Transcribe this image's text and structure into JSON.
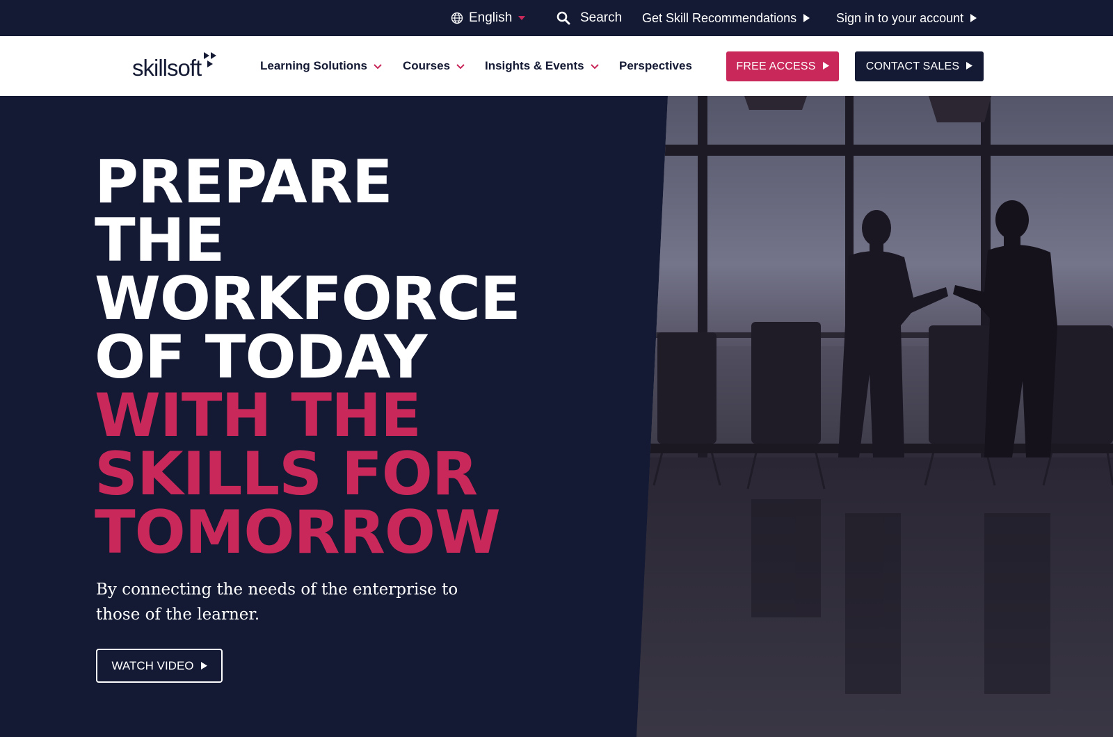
{
  "utility_bar": {
    "language": "English",
    "search_label": "Search",
    "recommendations_label": "Get Skill Recommendations",
    "signin_label": "Sign in to your account"
  },
  "logo": {
    "text": "skillsoft"
  },
  "nav": {
    "items": [
      {
        "label": "Learning Solutions",
        "has_dropdown": true
      },
      {
        "label": "Courses",
        "has_dropdown": true
      },
      {
        "label": "Insights & Events",
        "has_dropdown": true
      },
      {
        "label": "Perspectives",
        "has_dropdown": false
      }
    ],
    "free_access_label": "FREE ACCESS",
    "contact_sales_label": "CONTACT SALES"
  },
  "hero": {
    "headline_white": [
      "PREPARE",
      "THE",
      "WORKFORCE",
      "OF TODAY"
    ],
    "headline_pink": [
      "WITH THE",
      "SKILLS FOR",
      "TOMORROW"
    ],
    "subtext": "By connecting the needs of the enterprise to those of the learner.",
    "video_button_label": "WATCH VIDEO"
  },
  "icons": {
    "language": "globe-icon",
    "language_caret": "caret-down-icon",
    "search": "search-icon",
    "arrow": "play-arrow-icon",
    "nav_caret": "chevron-down-icon"
  },
  "colors": {
    "navy": "#141a33",
    "accent_pink": "#c8285a",
    "white": "#ffffff"
  }
}
